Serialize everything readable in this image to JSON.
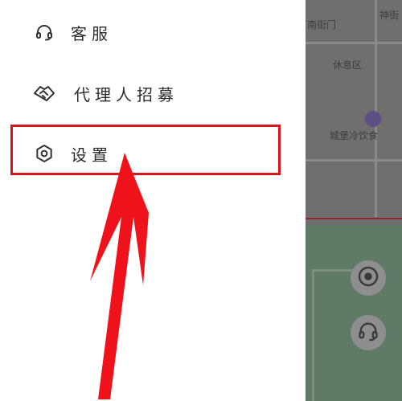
{
  "drawer": {
    "items": [
      {
        "label": "客服",
        "icon": "headset-icon"
      },
      {
        "label": "代理人招募",
        "icon": "handshake-icon"
      },
      {
        "label": "设置",
        "icon": "gear-icon"
      }
    ]
  },
  "map": {
    "labels": {
      "top_left": "南街门",
      "top_right": "神街",
      "middle": "休息区",
      "bottom": "城堡冷饮食"
    }
  },
  "colors": {
    "highlight": "#d9141a",
    "overlay": "#6f6f6f"
  }
}
